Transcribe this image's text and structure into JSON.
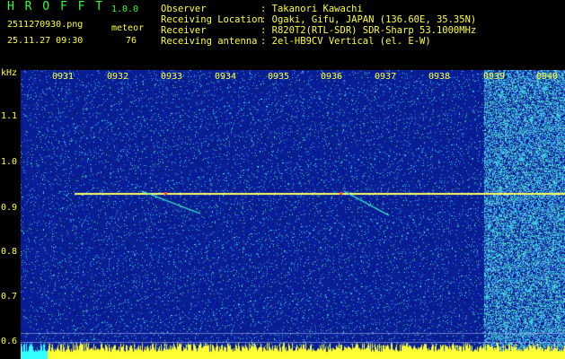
{
  "app": {
    "title": "H R O F F T",
    "version": "1.0.0",
    "filename": "2511270930.png",
    "datetime": "25.11.27 09:30",
    "mode_label": "meteor",
    "count": "76"
  },
  "info": [
    {
      "key": "Observer",
      "value": ": Takanori Kawachi"
    },
    {
      "key": "Receiving Location",
      "value": ": Ogaki, Gifu, JAPAN (136.60E, 35.35N)"
    },
    {
      "key": "Receiver",
      "value": ": R820T2(RTL-SDR) SDR-Sharp 53.1000MHz"
    },
    {
      "key": "Receiving antenna",
      "value": ": 2el-HB9CV Vertical (el. E-W)"
    }
  ],
  "axis": {
    "unit": "kHz",
    "y_ticks": [
      "1.1",
      "1.0",
      "0.9",
      "0.8",
      "0.7",
      "0.6"
    ],
    "x_ticks": [
      "0931",
      "0932",
      "0933",
      "0934",
      "0935",
      "0936",
      "0937",
      "0938",
      "0939",
      "0940"
    ]
  },
  "colors": {
    "background": "#000000",
    "spectrogram": "#0a1a9a",
    "carrier": "#ffff66",
    "label": "#ffff33",
    "title": "#33ff33"
  }
}
